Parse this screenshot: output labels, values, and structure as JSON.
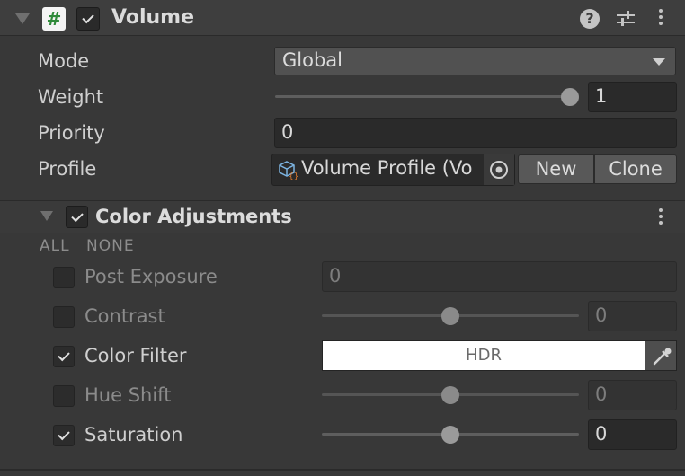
{
  "component": {
    "foldout_icon": "triangle-down-icon",
    "script_icon_glyph": "#",
    "enabled": true,
    "title": "Volume",
    "help_icon_glyph": "?",
    "icons": [
      "help-icon",
      "presets-icon",
      "kebab-menu-icon"
    ]
  },
  "fields": {
    "mode": {
      "label": "Mode",
      "value": "Global"
    },
    "weight": {
      "label": "Weight",
      "value": "1",
      "slider_fraction": 1.0
    },
    "priority": {
      "label": "Priority",
      "value": "0"
    },
    "profile": {
      "label": "Profile",
      "value": "Volume Profile (Vo",
      "new_label": "New",
      "clone_label": "Clone"
    }
  },
  "override": {
    "title": "Color Adjustments",
    "enabled": true,
    "all_label": "ALL",
    "none_label": "NONE",
    "params": [
      {
        "label": "Post Exposure",
        "overridden": false,
        "value": "0"
      },
      {
        "label": "Contrast",
        "overridden": false,
        "value": "0",
        "slider_fraction": 0.5
      },
      {
        "label": "Color Filter",
        "overridden": true,
        "color": "#ffffff",
        "hdr_label": "HDR"
      },
      {
        "label": "Hue Shift",
        "overridden": false,
        "value": "0",
        "slider_fraction": 0.5
      },
      {
        "label": "Saturation",
        "overridden": true,
        "value": "0",
        "slider_fraction": 0.5
      }
    ]
  }
}
